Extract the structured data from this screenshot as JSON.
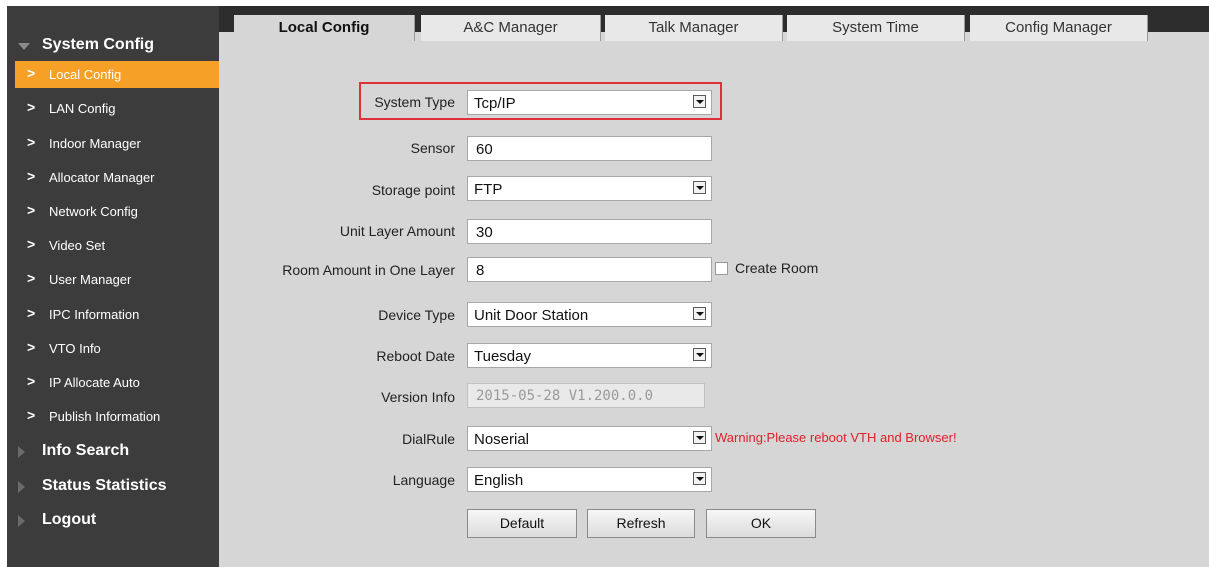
{
  "sidebar": {
    "system_config": "System Config",
    "items": [
      {
        "label": "Local Config"
      },
      {
        "label": "LAN Config"
      },
      {
        "label": "Indoor Manager"
      },
      {
        "label": "Allocator Manager"
      },
      {
        "label": "Network Config"
      },
      {
        "label": "Video Set"
      },
      {
        "label": "User Manager"
      },
      {
        "label": "IPC Information"
      },
      {
        "label": "VTO Info"
      },
      {
        "label": "IP Allocate Auto"
      },
      {
        "label": "Publish Information"
      }
    ],
    "info_search": "Info Search",
    "status_statistics": "Status Statistics",
    "logout": "Logout"
  },
  "tabs": [
    {
      "label": "Local Config"
    },
    {
      "label": "A&C Manager"
    },
    {
      "label": "Talk Manager"
    },
    {
      "label": "System Time"
    },
    {
      "label": "Config Manager"
    }
  ],
  "form": {
    "system_type": {
      "label": "System Type",
      "value": "Tcp/IP"
    },
    "sensor": {
      "label": "Sensor",
      "value": "60"
    },
    "storage_point": {
      "label": "Storage point",
      "value": "FTP"
    },
    "unit_layer_amount": {
      "label": "Unit Layer Amount",
      "value": "30"
    },
    "room_amount": {
      "label": "Room Amount in One Layer",
      "value": "8"
    },
    "create_room": "Create Room",
    "device_type": {
      "label": "Device Type",
      "value": "Unit Door Station"
    },
    "reboot_date": {
      "label": "Reboot Date",
      "value": "Tuesday"
    },
    "version_info": {
      "label": "Version Info",
      "value": "2015-05-28 V1.200.0.0"
    },
    "dial_rule": {
      "label": "DialRule",
      "value": "Noserial"
    },
    "warning": "Warning:Please reboot VTH and Browser!",
    "language": {
      "label": "Language",
      "value": "English"
    }
  },
  "buttons": {
    "default": "Default",
    "refresh": "Refresh",
    "ok": "OK"
  },
  "colors": {
    "active_item": "#f6a028",
    "highlight": "#e0313a",
    "warning": "#e0202a"
  }
}
